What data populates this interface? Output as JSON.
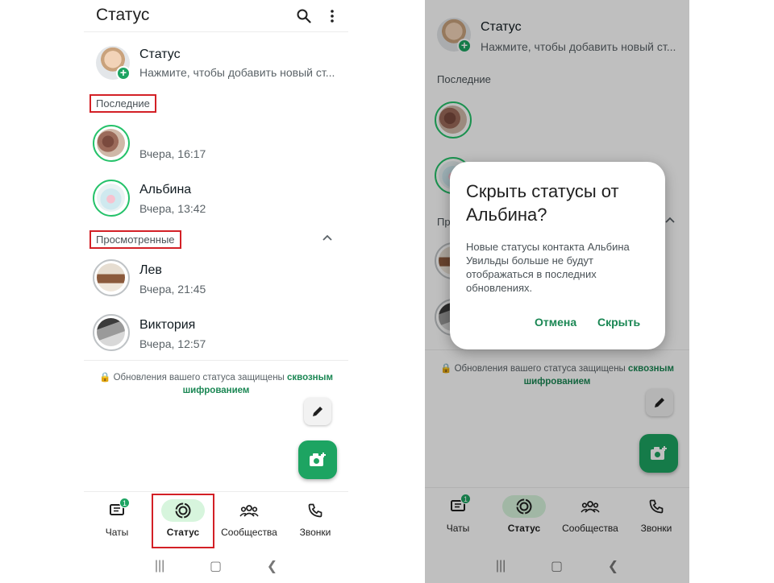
{
  "left_screen": {
    "header": {
      "title": "Статус",
      "search_icon": "search-icon",
      "menu_icon": "more-vert-icon"
    },
    "my_status": {
      "title": "Статус",
      "subtitle": "Нажмите, чтобы добавить новый ст..."
    },
    "recent": {
      "label": "Последние",
      "items": [
        {
          "name": "",
          "time": "Вчера, 16:17"
        },
        {
          "name": "Альбина",
          "time": "Вчера, 13:42"
        }
      ]
    },
    "viewed": {
      "label": "Просмотренные",
      "items": [
        {
          "name": "Лев",
          "time": "Вчера, 21:45"
        },
        {
          "name": "Виктория",
          "time": "Вчера, 12:57"
        }
      ]
    },
    "footer": {
      "text": "Обновления вашего статуса защищены",
      "link": "сквозным шифрованием"
    },
    "nav": [
      {
        "label": "Чаты",
        "icon": "chats-icon",
        "badge": "1"
      },
      {
        "label": "Статус",
        "icon": "status-icon"
      },
      {
        "label": "Сообщества",
        "icon": "communities-icon"
      },
      {
        "label": "Звонки",
        "icon": "calls-icon"
      }
    ]
  },
  "right_screen": {
    "my_status": {
      "title": "Статус",
      "subtitle": "Нажмите, чтобы добавить новый ст..."
    },
    "recent": {
      "label": "Последние"
    },
    "viewed": {
      "label": "Пр"
    },
    "footer": {
      "text": "Обновления вашего статуса защищены",
      "link": "сквозным шифрованием"
    },
    "dialog": {
      "title": "Скрыть статусы от Альбина?",
      "body": "Новые статусы контакта Альбина Увильды больше не будут отображаться в последних обновлениях.",
      "cancel": "Отмена",
      "confirm": "Скрыть"
    },
    "nav": [
      {
        "label": "Чаты",
        "badge": "1"
      },
      {
        "label": "Статус"
      },
      {
        "label": "Сообщества"
      },
      {
        "label": "Звонки"
      }
    ]
  },
  "colors": {
    "accent": "#1da462",
    "active_nav_bg": "#d7f5dd",
    "highlight_box": "#d32026",
    "link": "#1b8754"
  }
}
